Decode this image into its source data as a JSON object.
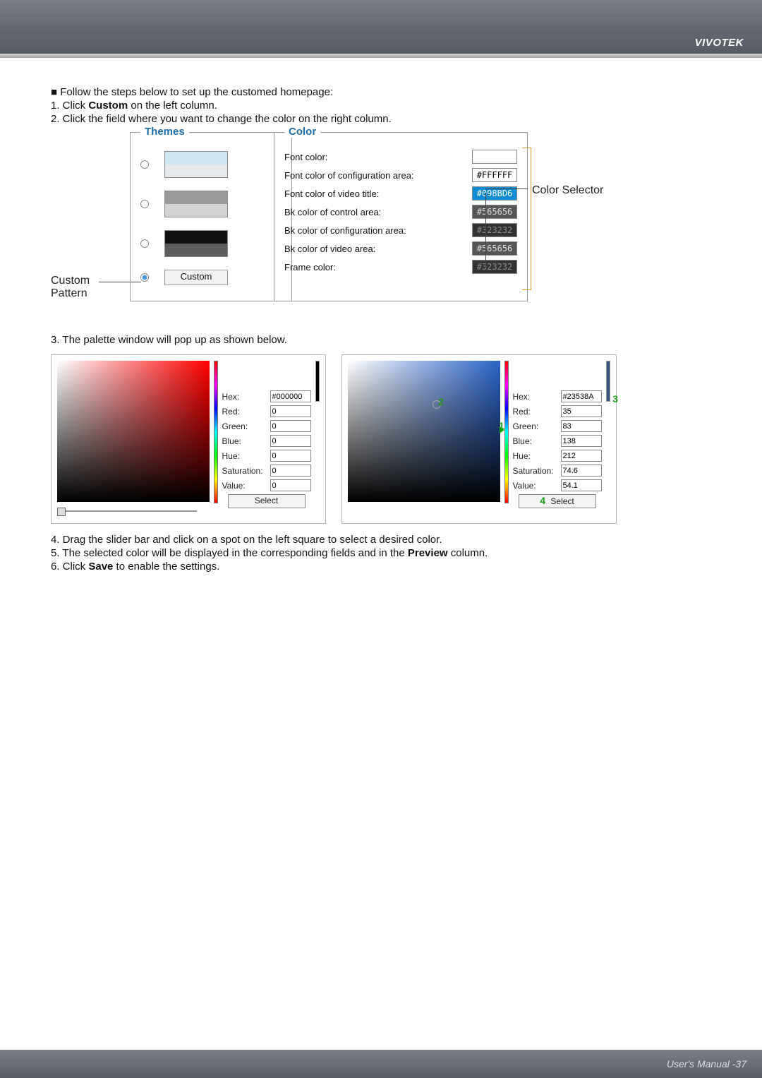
{
  "brand": "VIVOTEK",
  "intro": "■ Follow the steps below to set up the customed homepage:",
  "step1_pre": "1. Click ",
  "step1_b": "Custom",
  "step1_post": " on the left column.",
  "step2": "2. Click the field where you want to change the color on the right column.",
  "themes_legend": "Themes",
  "custom_btn": "Custom",
  "call_custom_1": "Custom",
  "call_custom_2": "Pattern",
  "color_legend": "Color",
  "color_rows": [
    {
      "label": "Font color:",
      "val": "",
      "bg": "#ffffff",
      "fg": "#000"
    },
    {
      "label": "Font color of configuration area:",
      "val": "#FFFFFF",
      "bg": "#ffffff",
      "fg": "#000"
    },
    {
      "label": "Font color of video title:",
      "val": "#098BD6",
      "bg": "#098BD6",
      "fg": "#fff"
    },
    {
      "label": "Bk color of control area:",
      "val": "#565656",
      "bg": "#565656",
      "fg": "#dedede"
    },
    {
      "label": "Bk color of configuration area:",
      "val": "#323232",
      "bg": "#323232",
      "fg": "#8b8b8b"
    },
    {
      "label": "Bk color of video area:",
      "val": "#565656",
      "bg": "#565656",
      "fg": "#dedede"
    },
    {
      "label": "Frame color:",
      "val": "#323232",
      "bg": "#323232",
      "fg": "#8b8b8b"
    }
  ],
  "call_selector": "Color Selector",
  "step3": "3. The palette window will pop up as shown below.",
  "palette_labels": {
    "hex": "Hex:",
    "red": "Red:",
    "green": "Green:",
    "blue": "Blue:",
    "hue": "Hue:",
    "sat": "Saturation:",
    "val": "Value:",
    "select": "Select"
  },
  "palette_a": {
    "hex": "#000000",
    "red": "0",
    "green": "0",
    "blue": "0",
    "hue": "0",
    "sat": "0",
    "val": "0"
  },
  "palette_b": {
    "hex": "#23538A",
    "red": "35",
    "green": "83",
    "blue": "138",
    "hue": "212",
    "sat": "74.6",
    "val": "54.1"
  },
  "ann": {
    "one": "1",
    "two": "2",
    "three": "3",
    "four": "4"
  },
  "step4": "4. Drag the slider bar and click on a spot on the left square to select a desired color.",
  "step5_pre": "5. The selected color will be displayed in the corresponding fields and in the ",
  "step5_b": "Preview",
  "step5_post": " column.",
  "step6_pre": "6. Click ",
  "step6_b": "Save",
  "step6_post": " to enable the settings.",
  "footer_pre": "User's Manual - ",
  "footer_page": "37"
}
